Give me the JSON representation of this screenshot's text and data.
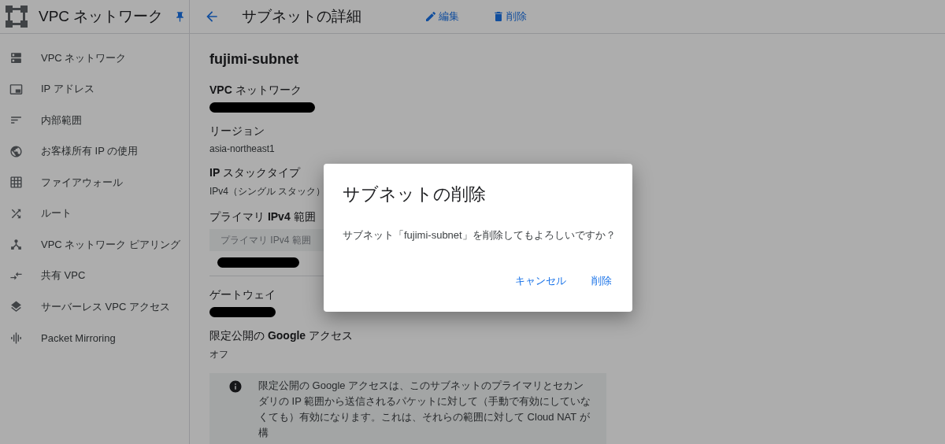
{
  "header": {
    "product_title": "VPC ネットワーク",
    "page_title": "サブネットの詳細",
    "actions": [
      {
        "label": "編集",
        "kind": "edit"
      },
      {
        "label": "削除",
        "kind": "delete"
      }
    ]
  },
  "sidebar": {
    "items": [
      {
        "label": "VPC ネットワーク"
      },
      {
        "label": "IP アドレス"
      },
      {
        "label": "内部範囲"
      },
      {
        "label": "お客様所有 IP の使用"
      },
      {
        "label": "ファイアウォール"
      },
      {
        "label": "ルート"
      },
      {
        "label": "VPC ネットワーク ピアリング"
      },
      {
        "label": "共有 VPC"
      },
      {
        "label": "サーバーレス VPC アクセス"
      },
      {
        "label": "Packet Mirroring"
      }
    ]
  },
  "details": {
    "name": "fujimi-subnet",
    "sections": [
      {
        "label": "**VPC** ネットワーク",
        "kind": "redacted"
      },
      {
        "label": "リージョン",
        "kind": "text",
        "value": "asia-northeast1"
      },
      {
        "label": "**IP** スタックタイプ",
        "kind": "text",
        "value": "IPv4（シングル スタック）"
      },
      {
        "label": "プライマリ **IPv4** 範囲",
        "kind": "table",
        "column": "プライマリ IPv4 範囲"
      },
      {
        "label": "ゲートウェイ",
        "kind": "redacted"
      },
      {
        "label": "限定公開の **Google** アクセス",
        "kind": "text",
        "value": "オフ"
      },
      {
        "kind": "info",
        "text": "限定公開の Google アクセスは、このサブネットのプライマリとセカンダリの IP 範囲から送信されるパケットに対して（手動で有効にしていなくても）有効になります。これは、それらの範囲に対して Cloud NAT が構"
      }
    ]
  },
  "dialog": {
    "title": "サブネットの削除",
    "message": "サブネット「fujimi-subnet」を削除してもよろしいですか？",
    "buttons": [
      "キャンセル",
      "削除"
    ]
  }
}
